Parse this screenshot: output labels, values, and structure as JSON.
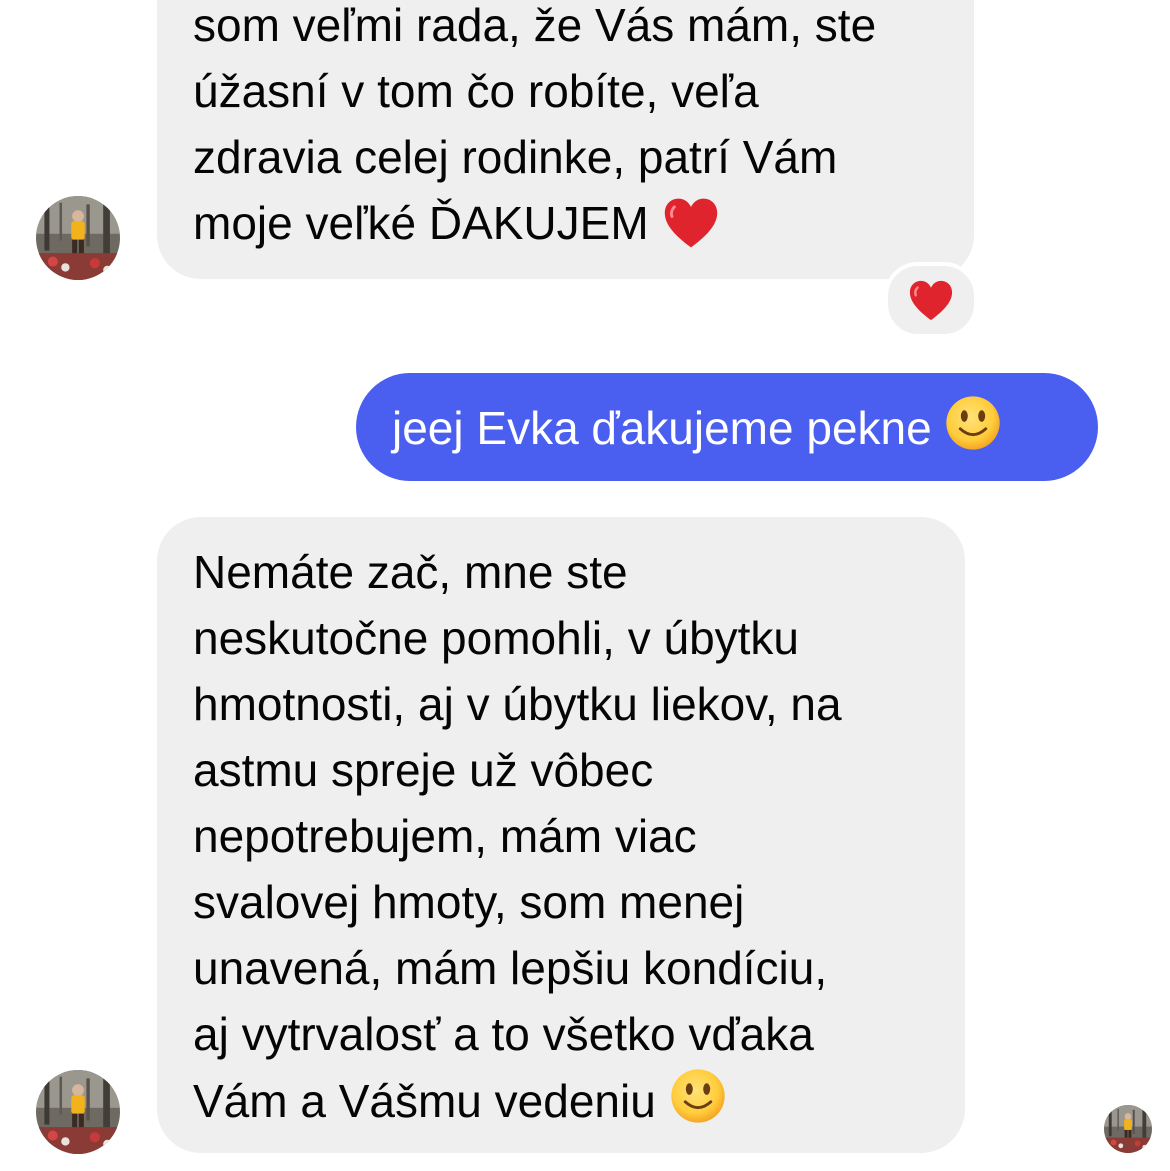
{
  "conversation": {
    "messages": [
      {
        "sender": "incoming",
        "lines": [
          "som veľmi rada, že Vás mám, ste",
          "úžasní v tom čo robíte, veľa",
          "zdravia celej rodinke, patrí Vám",
          "moje veľké ĎAKUJEM"
        ],
        "trailing_emoji": "red-heart-icon",
        "reaction_emoji": "red-heart-icon"
      },
      {
        "sender": "outgoing",
        "lines": [
          "jeej Evka ďakujeme pekne"
        ],
        "trailing_emoji": "slightly-smiling-face-icon"
      },
      {
        "sender": "incoming",
        "lines": [
          "Nemáte zač, mne ste",
          "neskutočne pomohli, v úbytku",
          "hmotnosti, aj v úbytku liekov, na",
          "astmu spreje už vôbec",
          "nepotrebujem, mám viac",
          "svalovej hmoty, som menej",
          "unavená, mám lepšiu kondíciu,",
          "aj vytrvalosť a to všetko vďaka",
          "Vám a Vášmu vedeniu"
        ],
        "trailing_emoji": "slightly-smiling-face-icon",
        "read_receipt": "seen-avatar"
      }
    ]
  },
  "colors": {
    "incoming_bubble": "#efefef",
    "outgoing_bubble": "#4a5ef0",
    "incoming_text": "#050505",
    "outgoing_text": "#ffffff",
    "heart": "#e0242e",
    "smile_face": "#ffc83d"
  }
}
